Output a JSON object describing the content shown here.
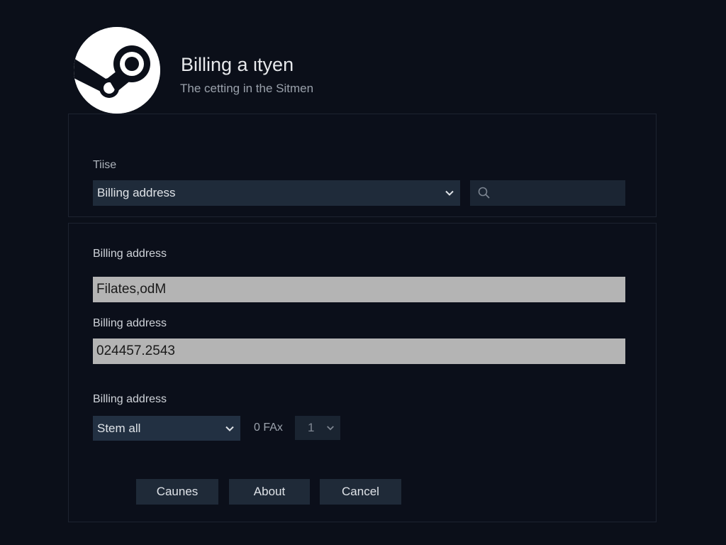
{
  "header": {
    "title": "Billing a ιtyen",
    "subtitle": "The cetting in the Sitmen"
  },
  "top_section": {
    "label": "Tiise",
    "select_value": "Billing address",
    "search_icon": "search-icon"
  },
  "form": {
    "field1_label": "Billing address",
    "field1_value": "Filates,odM",
    "field2_label": "Billing address",
    "field2_value": "024457.2543",
    "field3_label": "Billing address",
    "select_value": "Stem all",
    "fax_label": "0 FAx",
    "small_select_value": "1"
  },
  "buttons": {
    "btn1": "Caunes",
    "btn2": "About",
    "btn3": "Cancel"
  },
  "icons": {
    "logo": "steam-logo",
    "chevron": "chevron-down-icon"
  },
  "colors": {
    "background": "#0b0f19",
    "input_dark": "#1f2b3a",
    "input_light": "#b4b4b4"
  }
}
